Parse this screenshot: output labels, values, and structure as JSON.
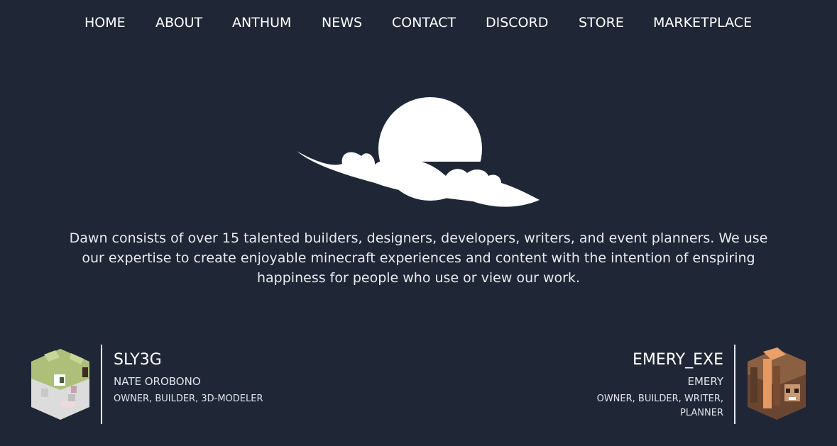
{
  "nav": {
    "items": [
      {
        "label": "HOME"
      },
      {
        "label": "ABOUT"
      },
      {
        "label": "ANTHUM"
      },
      {
        "label": "NEWS"
      },
      {
        "label": "CONTACT"
      },
      {
        "label": "DISCORD"
      },
      {
        "label": "STORE"
      },
      {
        "label": "MARKETPLACE"
      }
    ]
  },
  "logo": {
    "icon": "sun-behind-cloud-icon",
    "color": "#ffffff"
  },
  "intro": {
    "text": "Dawn consists of over 15 talented builders, designers, developers, writers, and event planners. We use our expertise to create enjoyable minecraft experiences and content with the intention of enspiring happiness for people who use or view our work."
  },
  "team": [
    {
      "handle": "SLY3G",
      "name": "NATE OROBONO",
      "roles": "OWNER, BUILDER, 3D-MODELER",
      "avatar_icon": "minecraft-head-avatar"
    },
    {
      "handle": "EMERY_EXE",
      "name": "EMERY",
      "roles": "OWNER, BUILDER, WRITER, PLANNER",
      "avatar_icon": "minecraft-head-avatar"
    }
  ],
  "colors": {
    "background": "#1f2737",
    "text": "#ffffff",
    "divider": "#e6e8ec"
  }
}
